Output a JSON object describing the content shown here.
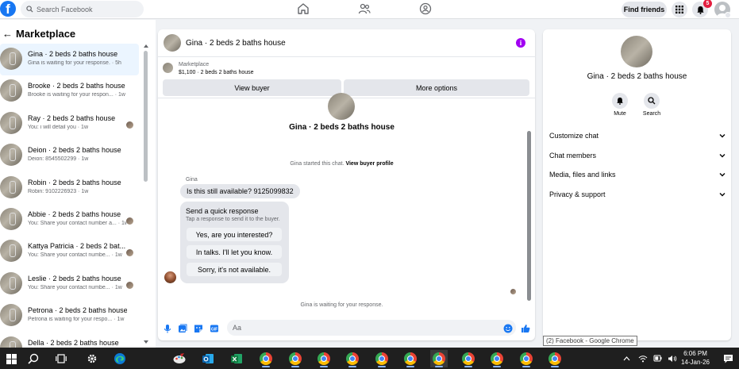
{
  "topbar": {
    "logo": "f",
    "search_placeholder": "Search Facebook",
    "find_friends": "Find friends",
    "notification_count": "5"
  },
  "sidebar": {
    "title": "Marketplace",
    "conversations": [
      {
        "name": "Gina · 2 beds 2 baths house",
        "preview": "Gina is waiting for your response. · 5h",
        "active": true,
        "seen": false
      },
      {
        "name": "Brooke · 2 beds 2 baths house",
        "preview": "Brooke is waiting for your respon... · 1w",
        "active": false,
        "seen": false
      },
      {
        "name": "Ray · 2 beds 2 baths house",
        "preview": "You: i will detail you · 1w",
        "active": false,
        "seen": true
      },
      {
        "name": "Deion · 2 beds 2 baths house",
        "preview": "Deion: 8545502299 · 1w",
        "active": false,
        "seen": false
      },
      {
        "name": "Robin · 2 beds 2 baths house",
        "preview": "Robin: 9102226923 · 1w",
        "active": false,
        "seen": false
      },
      {
        "name": "Abbie · 2 beds 2 baths house",
        "preview": "You: Share your contact number a... · 1w",
        "active": false,
        "seen": true
      },
      {
        "name": "Kattya Patricia · 2 beds 2 bat...",
        "preview": "You: Share your contact numbe... · 1w",
        "active": false,
        "seen": true
      },
      {
        "name": "Leslie · 2 beds 2 baths house",
        "preview": "You: Share your contact numbe... · 1w",
        "active": false,
        "seen": true
      },
      {
        "name": "Petrona · 2 beds 2 baths house",
        "preview": "Petrona is waiting for your respo... · 1w",
        "active": false,
        "seen": false
      },
      {
        "name": "Della · 2 beds 2 baths house",
        "preview": "",
        "active": false,
        "seen": false
      }
    ]
  },
  "chat": {
    "header_name": "Gina · 2 beds 2 baths house",
    "marketplace_label": "Marketplace",
    "listing": "$1,100 · 2 beds 2 baths house",
    "view_buyer": "View buyer",
    "more_options": "More options",
    "big_name": "Gina · 2 beds 2 baths house",
    "started_text": "Gina started this chat.",
    "view_buyer_profile": "View buyer profile",
    "sender": "Gina",
    "message": "Is this still available? 9125099832",
    "quick_title": "Send a quick response",
    "quick_sub": "Tap a response to send it to the buyer.",
    "quick_replies": [
      "Yes, are you interested?",
      "In talks. I'll let you know.",
      "Sorry, it's not available."
    ],
    "waiting": "Gina is waiting for your response.",
    "composer_placeholder": "Aa"
  },
  "details": {
    "name": "Gina · 2 beds 2 baths house",
    "mute": "Mute",
    "search": "Search",
    "rows": [
      "Customize chat",
      "Chat members",
      "Media, files and links",
      "Privacy & support"
    ]
  },
  "tooltip": "(2) Facebook - Google Chrome",
  "taskbar": {
    "time": "6:06 PM",
    "date": "14-Jan-26"
  },
  "colors": {
    "brand": "#1877f2",
    "info": "#a100f2",
    "badge": "#e41e3f"
  }
}
